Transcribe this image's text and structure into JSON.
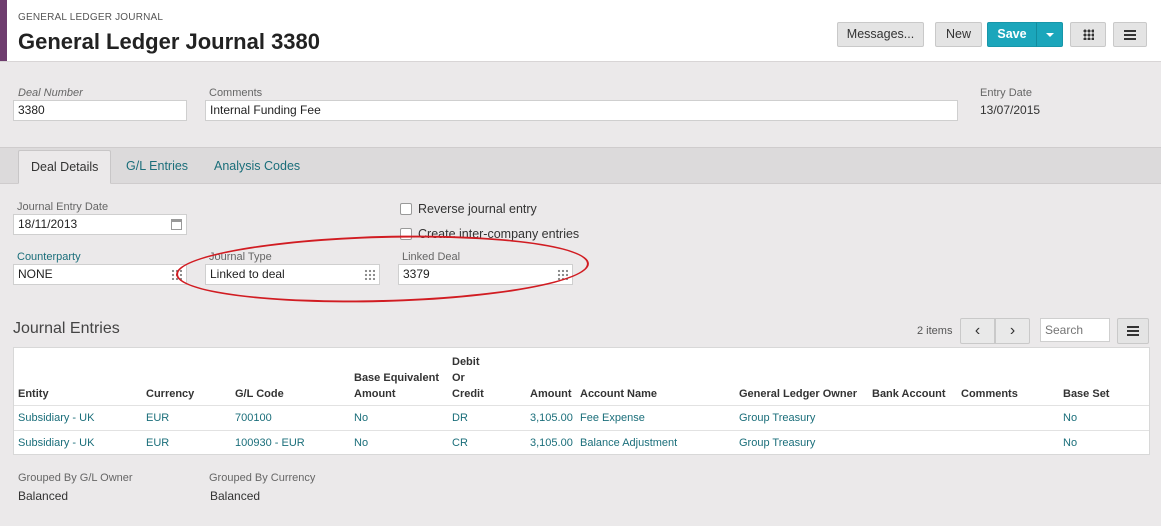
{
  "header": {
    "breadcrumb": "GENERAL LEDGER JOURNAL",
    "title": "General Ledger Journal 3380",
    "buttons": {
      "messages": "Messages...",
      "new": "New",
      "save": "Save"
    }
  },
  "form": {
    "deal_number": {
      "label": "Deal Number",
      "value": "3380"
    },
    "comments": {
      "label": "Comments",
      "value": "Internal Funding Fee"
    },
    "entry_date": {
      "label": "Entry Date",
      "value": "13/07/2015"
    }
  },
  "tabs": [
    {
      "label": "Deal Details",
      "active": true
    },
    {
      "label": "G/L Entries",
      "active": false
    },
    {
      "label": "Analysis Codes",
      "active": false
    }
  ],
  "deal_details": {
    "journal_entry_date": {
      "label": "Journal Entry Date",
      "value": "18/11/2013"
    },
    "counterparty": {
      "label": "Counterparty",
      "value": "NONE"
    },
    "journal_type": {
      "label": "Journal Type",
      "value": "Linked to deal"
    },
    "linked_deal": {
      "label": "Linked Deal",
      "value": "3379"
    },
    "reverse_journal_entry": {
      "label": "Reverse journal entry",
      "checked": false
    },
    "create_intercompany": {
      "label": "Create inter-company entries",
      "checked": false
    }
  },
  "journal_entries": {
    "title": "Journal Entries",
    "items_count": "2 items",
    "search_placeholder": "Search",
    "columns": {
      "entity": "Entity",
      "currency": "Currency",
      "gl_code": "G/L Code",
      "base_eq_line1": "Base Equivalent",
      "base_eq_line2": "Amount",
      "debit_line1": "Debit",
      "debit_line2": "Or",
      "debit_line3": "Credit",
      "amount": "Amount",
      "account_name": "Account Name",
      "gl_owner": "General Ledger Owner",
      "bank_account": "Bank Account",
      "comments": "Comments",
      "base_set": "Base Set"
    },
    "rows": [
      {
        "entity": "Subsidiary - UK",
        "currency": "EUR",
        "gl_code": "700100",
        "base_eq": "No",
        "dr_cr": "DR",
        "amount": "3,105.00",
        "account_name": "Fee Expense",
        "gl_owner": "Group Treasury",
        "bank_account": "",
        "comments": "",
        "base_set": "No"
      },
      {
        "entity": "Subsidiary - UK",
        "currency": "EUR",
        "gl_code": "100930 - EUR",
        "base_eq": "No",
        "dr_cr": "CR",
        "amount": "3,105.00",
        "account_name": "Balance Adjustment",
        "gl_owner": "Group Treasury",
        "bank_account": "",
        "comments": "",
        "base_set": "No"
      }
    ]
  },
  "summary": {
    "by_gl_owner": {
      "label": "Grouped By G/L Owner",
      "value": "Balanced"
    },
    "by_currency": {
      "label": "Grouped By Currency",
      "value": "Balanced"
    }
  },
  "colors": {
    "accent": "#6e3d6e",
    "primary": "#1ba6bb",
    "link": "#1a6e7a",
    "annotation": "#d11c22"
  }
}
